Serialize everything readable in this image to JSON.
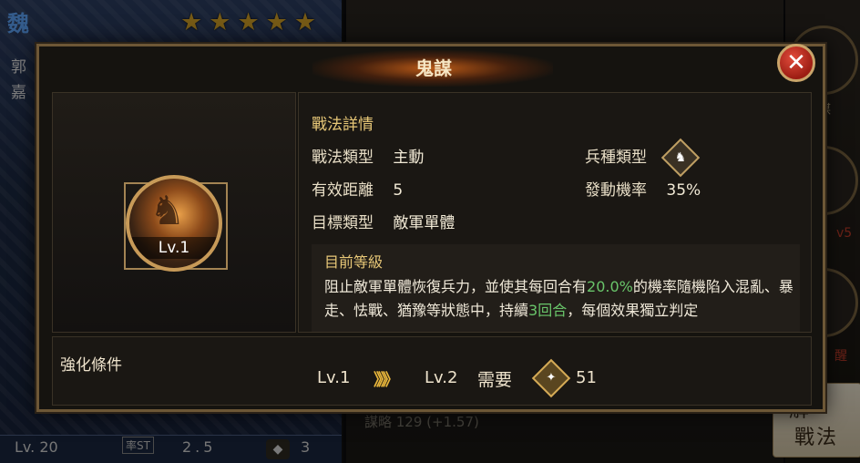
{
  "background": {
    "left_card": {
      "kingdom": "魏",
      "hero_name": "郭嘉",
      "stars": [
        "★",
        "★",
        "★",
        "★",
        "★"
      ],
      "level": "Lv. 20",
      "rate_label": "率ST",
      "rate_value": "2.5",
      "unit_value": "3"
    },
    "right_card": {
      "stat_line": "謀略 129 (+1.57)",
      "side_labels": [
        "謀",
        "v5",
        "醒"
      ],
      "unlock_button": {
        "line1": "解",
        "line2": "戰法"
      }
    }
  },
  "dialog": {
    "title": "鬼謀",
    "close_label": "✕",
    "skill_level": "Lv.1",
    "details": {
      "section_title": "戰法詳情",
      "rows": [
        {
          "label": "戰法類型",
          "value": "主動"
        },
        {
          "label": "有效距離",
          "value": "5"
        },
        {
          "label": "目標類型",
          "value": "敵軍單體"
        },
        {
          "label": "兵種類型",
          "value": ""
        },
        {
          "label": "發動機率",
          "value": "35%"
        }
      ],
      "current_level_label": "目前等級",
      "description_parts": [
        "阻止敵軍單體恢復兵力，並使其每回合有",
        "20.0%",
        "的機率隨機陷入混亂、暴走、怯戰、猶豫等狀態中，持續",
        "3回合",
        "，每個效果獨立判定"
      ]
    },
    "upgrade": {
      "title": "強化條件",
      "from_level": "Lv.1",
      "arrows": "》》》",
      "to_level": "Lv.2",
      "need_label": "需要",
      "cost": "51"
    }
  },
  "colors": {
    "accent_gold": "#e7c777",
    "highlight_green": "#69c56a",
    "close_red": "#c0281b"
  }
}
